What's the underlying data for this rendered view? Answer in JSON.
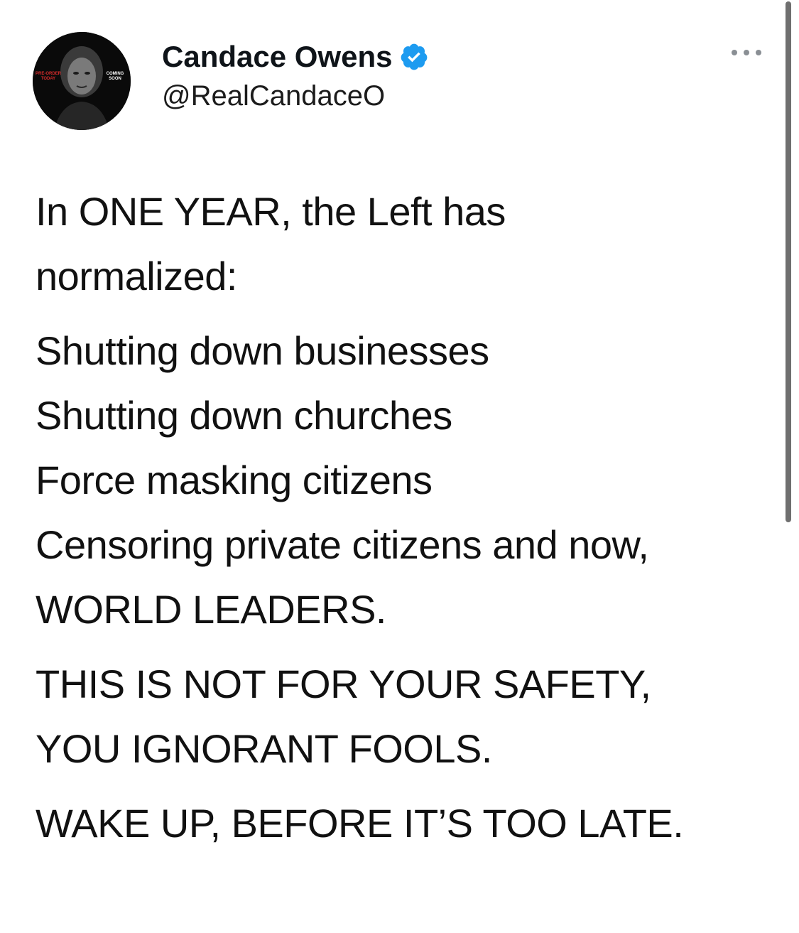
{
  "header": {
    "display_name": "Candace Owens",
    "handle": "@RealCandaceO",
    "verified_icon": "verified-badge-icon",
    "more_icon": "more-horizontal-icon",
    "accent_color": "#1d9bf0",
    "avatar_text": {
      "left": [
        "PRE-ORDER",
        "TODAY"
      ],
      "right": [
        "COMING",
        "SOON"
      ]
    }
  },
  "tweet": {
    "paragraphs": [
      [
        "In ONE YEAR, the Left has",
        "normalized:"
      ],
      [
        "Shutting down businesses",
        "Shutting down churches",
        "Force masking citizens",
        "Censoring private citizens and now,",
        "WORLD LEADERS."
      ],
      [
        "THIS IS NOT FOR YOUR SAFETY,",
        "YOU IGNORANT FOOLS."
      ],
      [
        "WAKE UP, BEFORE IT’S TOO LATE."
      ]
    ]
  }
}
